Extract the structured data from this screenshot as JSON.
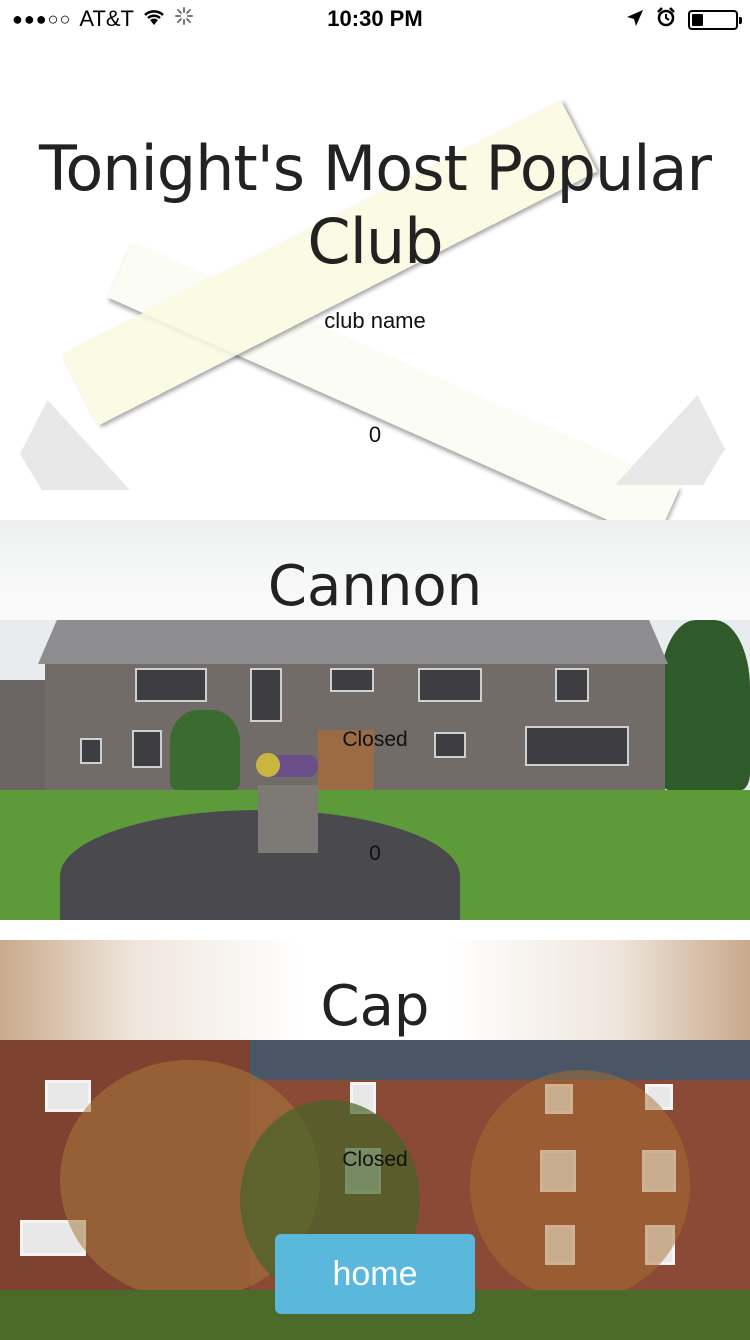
{
  "status_bar": {
    "signal": "●●●○○",
    "carrier": "AT&T",
    "time": "10:30 PM"
  },
  "popular": {
    "title": "Tonight's Most Popular Club",
    "club_name": "club name",
    "count": "0"
  },
  "clubs": [
    {
      "name": "Cannon",
      "status": "Closed",
      "count": "0"
    },
    {
      "name": "Cap",
      "status": "Closed"
    }
  ],
  "home_button": {
    "label": "home",
    "color": "#5bb8dd"
  }
}
